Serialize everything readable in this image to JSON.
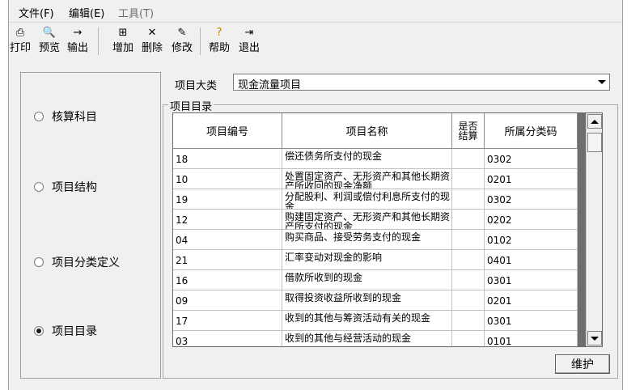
{
  "menubar": {
    "items": [
      {
        "label": "文件(F)",
        "enabled": true
      },
      {
        "label": "编辑(E)",
        "enabled": true
      },
      {
        "label": "工具(T)",
        "enabled": false
      }
    ]
  },
  "toolbar": {
    "buttons": [
      {
        "label": "打印",
        "icon": "printer-icon"
      },
      {
        "label": "预览",
        "icon": "preview-icon"
      },
      {
        "label": "输出",
        "icon": "export-icon"
      },
      {
        "label": "增加",
        "icon": "add-icon"
      },
      {
        "label": "删除",
        "icon": "delete-icon"
      },
      {
        "label": "修改",
        "icon": "edit-icon"
      },
      {
        "label": "帮助",
        "icon": "help-icon"
      },
      {
        "label": "退出",
        "icon": "exit-icon"
      }
    ]
  },
  "left_panel": {
    "options": [
      {
        "label": "核算科目",
        "checked": false
      },
      {
        "label": "项目结构",
        "checked": false
      },
      {
        "label": "项目分类定义",
        "checked": false
      },
      {
        "label": "项目目录",
        "checked": true
      }
    ]
  },
  "category": {
    "label": "项目大类",
    "value": "现金流量项目"
  },
  "directory": {
    "title": "项目目录",
    "columns": [
      "项目编号",
      "项目名称",
      "是否结算",
      "所属分类码"
    ],
    "rows": [
      {
        "code": "18",
        "name": "偿还债务所支付的现金",
        "settled": "",
        "category": "0302"
      },
      {
        "code": "10",
        "name": "处置固定资产、无形资产和其他长期资产所收回的现金净额",
        "settled": "",
        "category": "0201"
      },
      {
        "code": "19",
        "name": "分配股利、利润或偿付利息所支付的现金",
        "settled": "",
        "category": "0302"
      },
      {
        "code": "12",
        "name": "购建固定资产、无形资产和其他长期资产所支付的现金",
        "settled": "",
        "category": "0202"
      },
      {
        "code": "04",
        "name": "购买商品、接受劳务支付的现金",
        "settled": "",
        "category": "0102"
      },
      {
        "code": "21",
        "name": "汇率变动对现金的影响",
        "settled": "",
        "category": "0401"
      },
      {
        "code": "16",
        "name": "借款所收到的现金",
        "settled": "",
        "category": "0301"
      },
      {
        "code": "09",
        "name": "取得投资收益所收到的现金",
        "settled": "",
        "category": "0201"
      },
      {
        "code": "17",
        "name": "收到的其他与筹资活动有关的现金",
        "settled": "",
        "category": "0301"
      },
      {
        "code": "03",
        "name": "收到的其他与经营活动的现金",
        "settled": "",
        "category": "0101"
      }
    ]
  },
  "maintain_button": "维护"
}
